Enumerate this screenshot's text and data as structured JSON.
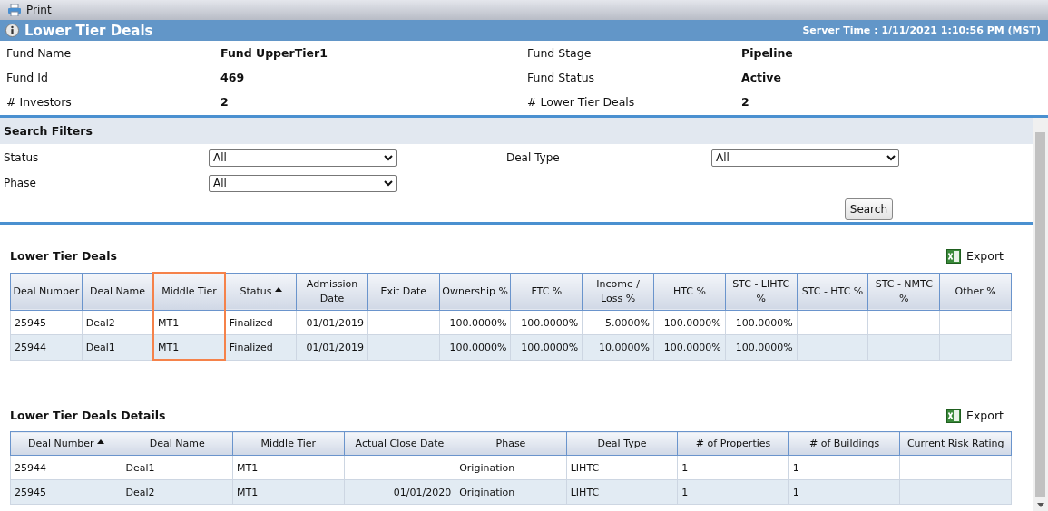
{
  "toolbar": {
    "print_label": "Print"
  },
  "title_bar": {
    "title": "Lower Tier Deals",
    "server_time": "Server Time : 1/11/2021 1:10:56 PM (MST)"
  },
  "fund_info": [
    {
      "label": "Fund Name",
      "value": "Fund UpperTier1"
    },
    {
      "label": "Fund Stage",
      "value": "Pipeline"
    },
    {
      "label": "Fund Id",
      "value": "469"
    },
    {
      "label": "Fund Status",
      "value": "Active"
    },
    {
      "label": "# Investors",
      "value": "2"
    },
    {
      "label": "# Lower Tier Deals",
      "value": "2"
    }
  ],
  "search_filters": {
    "title": "Search Filters",
    "filters": [
      {
        "label": "Status",
        "value": "All"
      },
      {
        "label": "Deal Type",
        "value": "All"
      },
      {
        "label": "Phase",
        "value": "All"
      }
    ],
    "button": "Search"
  },
  "tables": [
    {
      "title": "Lower Tier Deals",
      "export_label": "Export",
      "columns": [
        {
          "label": "Deal Number",
          "kind": "text",
          "sorted": false,
          "highlighted": false
        },
        {
          "label": "Deal Name",
          "kind": "text",
          "sorted": false,
          "highlighted": false
        },
        {
          "label": "Middle Tier",
          "kind": "text",
          "sorted": false,
          "highlighted": true
        },
        {
          "label": "Status",
          "kind": "text",
          "sorted": true,
          "highlighted": false
        },
        {
          "label": "Admission Date",
          "kind": "numeric",
          "sorted": false,
          "highlighted": false
        },
        {
          "label": "Exit Date",
          "kind": "numeric",
          "sorted": false,
          "highlighted": false
        },
        {
          "label": "Ownership %",
          "kind": "numeric",
          "sorted": false,
          "highlighted": false
        },
        {
          "label": "FTC %",
          "kind": "numeric",
          "sorted": false,
          "highlighted": false
        },
        {
          "label": "Income / Loss %",
          "kind": "numeric",
          "sorted": false,
          "highlighted": false
        },
        {
          "label": "HTC %",
          "kind": "numeric",
          "sorted": false,
          "highlighted": false
        },
        {
          "label": "STC - LIHTC %",
          "kind": "numeric",
          "sorted": false,
          "highlighted": false
        },
        {
          "label": "STC - HTC %",
          "kind": "numeric",
          "sorted": false,
          "highlighted": false
        },
        {
          "label": "STC - NMTC %",
          "kind": "numeric",
          "sorted": false,
          "highlighted": false
        },
        {
          "label": "Other %",
          "kind": "numeric",
          "sorted": false,
          "highlighted": false
        }
      ],
      "rows": [
        [
          "25945",
          "Deal2",
          "MT1",
          "Finalized",
          "01/01/2019",
          "",
          "100.0000%",
          "100.0000%",
          "5.0000%",
          "100.0000%",
          "100.0000%",
          "",
          "",
          ""
        ],
        [
          "25944",
          "Deal1",
          "MT1",
          "Finalized",
          "01/01/2019",
          "",
          "100.0000%",
          "100.0000%",
          "10.0000%",
          "100.0000%",
          "100.0000%",
          "",
          "",
          ""
        ]
      ]
    },
    {
      "title": "Lower Tier Deals Details",
      "export_label": "Export",
      "columns": [
        {
          "label": "Deal Number",
          "kind": "text",
          "sorted": true,
          "highlighted": false
        },
        {
          "label": "Deal Name",
          "kind": "text",
          "sorted": false,
          "highlighted": false
        },
        {
          "label": "Middle Tier",
          "kind": "text",
          "sorted": false,
          "highlighted": false
        },
        {
          "label": "Actual Close Date",
          "kind": "numeric",
          "sorted": false,
          "highlighted": false
        },
        {
          "label": "Phase",
          "kind": "text",
          "sorted": false,
          "highlighted": false
        },
        {
          "label": "Deal Type",
          "kind": "text",
          "sorted": false,
          "highlighted": false
        },
        {
          "label": "# of Properties",
          "kind": "text",
          "sorted": false,
          "highlighted": false
        },
        {
          "label": "# of Buildings",
          "kind": "text",
          "sorted": false,
          "highlighted": false
        },
        {
          "label": "Current Risk Rating",
          "kind": "text",
          "sorted": false,
          "highlighted": false
        }
      ],
      "rows": [
        [
          "25944",
          "Deal1",
          "MT1",
          "",
          "Origination",
          "LIHTC",
          "1",
          "1",
          ""
        ],
        [
          "25945",
          "Deal2",
          "MT1",
          "01/01/2020",
          "Origination",
          "LIHTC",
          "1",
          "1",
          ""
        ]
      ]
    }
  ]
}
